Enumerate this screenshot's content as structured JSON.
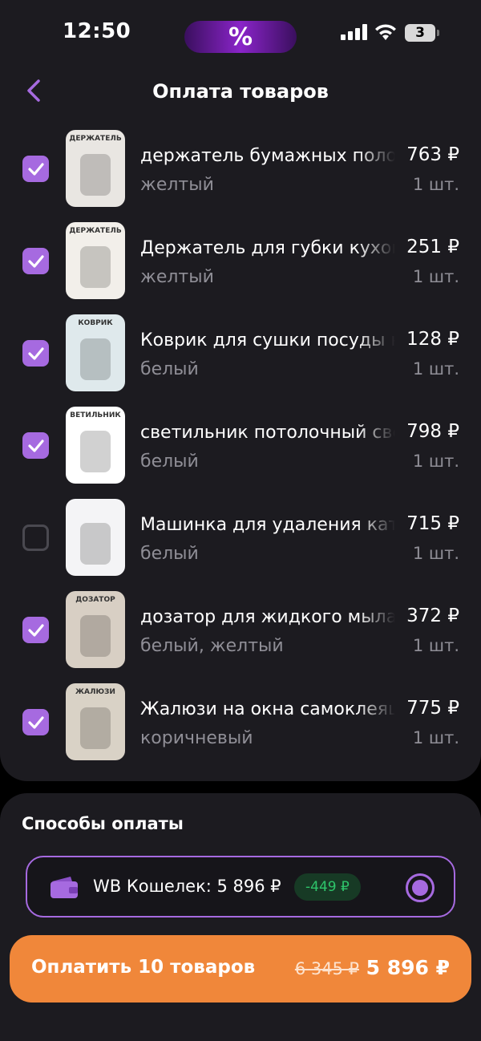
{
  "status_bar": {
    "time": "12:50",
    "island_label": "%",
    "battery": "3"
  },
  "header": {
    "title": "Оплата товаров"
  },
  "items": [
    {
      "name": "держатель бумажных полотенец",
      "color": "желтый",
      "price": "763 ₽",
      "qty": "1 шт.",
      "checked": true
    },
    {
      "name": "Держатель для губки кухонный",
      "color": "желтый",
      "price": "251 ₽",
      "qty": "1 шт.",
      "checked": true
    },
    {
      "name": "Коврик для сушки посуды на",
      "color": "белый",
      "price": "128 ₽",
      "qty": "1 шт.",
      "checked": true
    },
    {
      "name": "светильник потолочный свето",
      "color": "белый",
      "price": "798 ₽",
      "qty": "1 шт.",
      "checked": true
    },
    {
      "name": "Машинка для удаления катышков",
      "color": "белый",
      "price": "715 ₽",
      "qty": "1 шт.",
      "checked": false
    },
    {
      "name": "дозатор для жидкого мыла в",
      "color": "белый, желтый",
      "price": "372 ₽",
      "qty": "1 шт.",
      "checked": true
    },
    {
      "name": "Жалюзи на окна самоклеящиеся",
      "color": "коричневый",
      "price": "775 ₽",
      "qty": "1 шт.",
      "checked": true
    }
  ],
  "thumb_texts": [
    "ДЕРЖАТЕЛЬ",
    "ДЕРЖАТЕЛЬ",
    "КОВРИК",
    "ВЕТИЛЬНИК",
    "",
    "ДОЗАТОР",
    "ЖАЛЮЗИ"
  ],
  "payment": {
    "title": "Способы оплаты",
    "method_label": "WB Кошелек: 5 896 ₽",
    "discount": "-449 ₽",
    "selected": true
  },
  "pay_button": {
    "label": "Оплатить 10 товаров",
    "old_price": "6 345 ₽",
    "new_price": "5 896 ₽"
  },
  "colors": {
    "accent": "#a66ae0",
    "button": "#f0873a",
    "card": "#1c1b20",
    "discount": "#2ec46a"
  }
}
